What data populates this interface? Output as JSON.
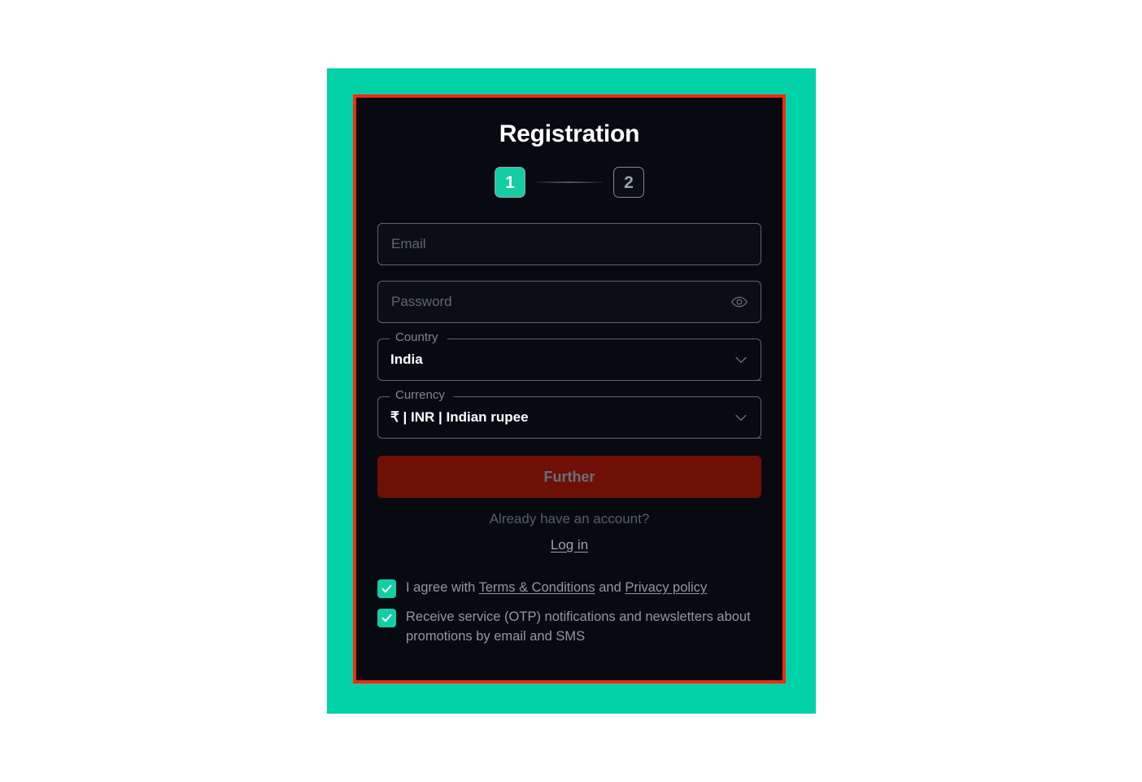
{
  "card": {
    "title": "Registration",
    "accent_teal": "#00d1a7",
    "highlight_border": "#fc2a07",
    "background": "#080a11"
  },
  "stepper": {
    "steps": [
      {
        "label": "1",
        "state": "active"
      },
      {
        "label": "2",
        "state": "inactive"
      }
    ]
  },
  "form": {
    "email": {
      "placeholder": "Email",
      "value": ""
    },
    "password": {
      "placeholder": "Password",
      "value": "",
      "toggle_icon": "eye-icon"
    },
    "country": {
      "label": "Country",
      "value": "India",
      "chevron_icon": "chevron-down-icon"
    },
    "currency": {
      "label": "Currency",
      "value": "₹ | INR | Indian rupee",
      "chevron_icon": "chevron-down-icon"
    },
    "submit_label": "Further"
  },
  "login": {
    "prompt": "Already have an account?",
    "link_label": "Log in"
  },
  "consent": {
    "terms": {
      "prefix": "I agree with ",
      "terms_link": "Terms & Conditions",
      "middle": " and ",
      "privacy_link": "Privacy policy",
      "checked": true
    },
    "marketing": {
      "text": "Receive service (OTP) notifications and newsletters about promotions by email and SMS",
      "checked": true
    }
  }
}
